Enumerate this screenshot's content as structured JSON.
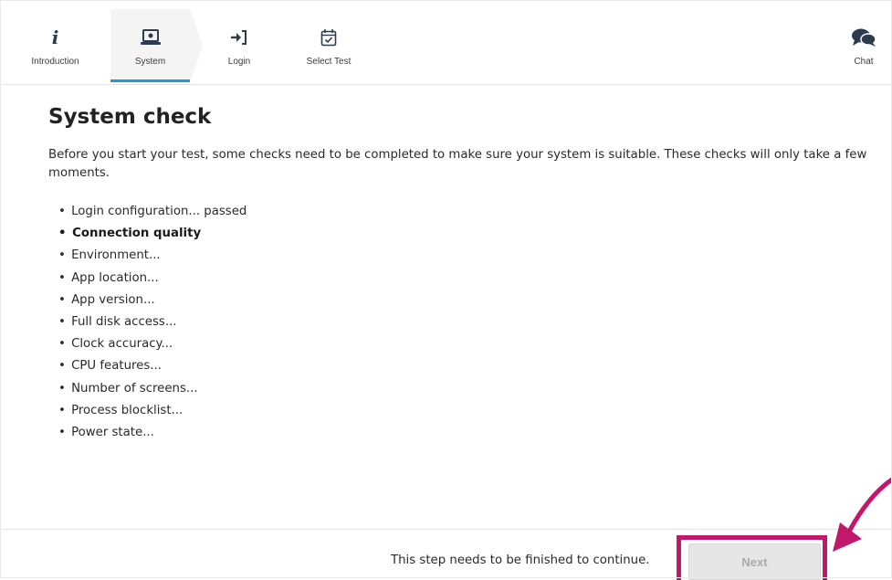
{
  "nav": {
    "items": [
      {
        "label": "Introduction",
        "icon": "info-icon"
      },
      {
        "label": "System",
        "icon": "laptop-icon",
        "active": true
      },
      {
        "label": "Login",
        "icon": "login-icon"
      },
      {
        "label": "Select Test",
        "icon": "calendar-check-icon"
      }
    ],
    "chat": {
      "label": "Chat",
      "icon": "chat-bubbles-icon"
    }
  },
  "main": {
    "title": "System check",
    "intro": "Before you start your test, some checks need to be completed to make sure your system is suitable. These checks will only take a few moments.",
    "bullet": "•",
    "checks": [
      {
        "text": "Login configuration... passed",
        "current": false
      },
      {
        "text": "Connection quality",
        "current": true
      },
      {
        "text": "Environment...",
        "current": false
      },
      {
        "text": "App location...",
        "current": false
      },
      {
        "text": "App version...",
        "current": false
      },
      {
        "text": "Full disk access...",
        "current": false
      },
      {
        "text": "Clock accuracy...",
        "current": false
      },
      {
        "text": "CPU features...",
        "current": false
      },
      {
        "text": "Number of screens...",
        "current": false
      },
      {
        "text": "Process blocklist...",
        "current": false
      },
      {
        "text": "Power state...",
        "current": false
      }
    ]
  },
  "footer": {
    "message": "This step needs to be finished to continue.",
    "next_label": "Next",
    "next_disabled": true
  },
  "colors": {
    "accent": "#1a9ad6",
    "annotation": "#c0186b",
    "disabled_bg": "#e6e6e6",
    "disabled_text": "#a9a9a9"
  }
}
